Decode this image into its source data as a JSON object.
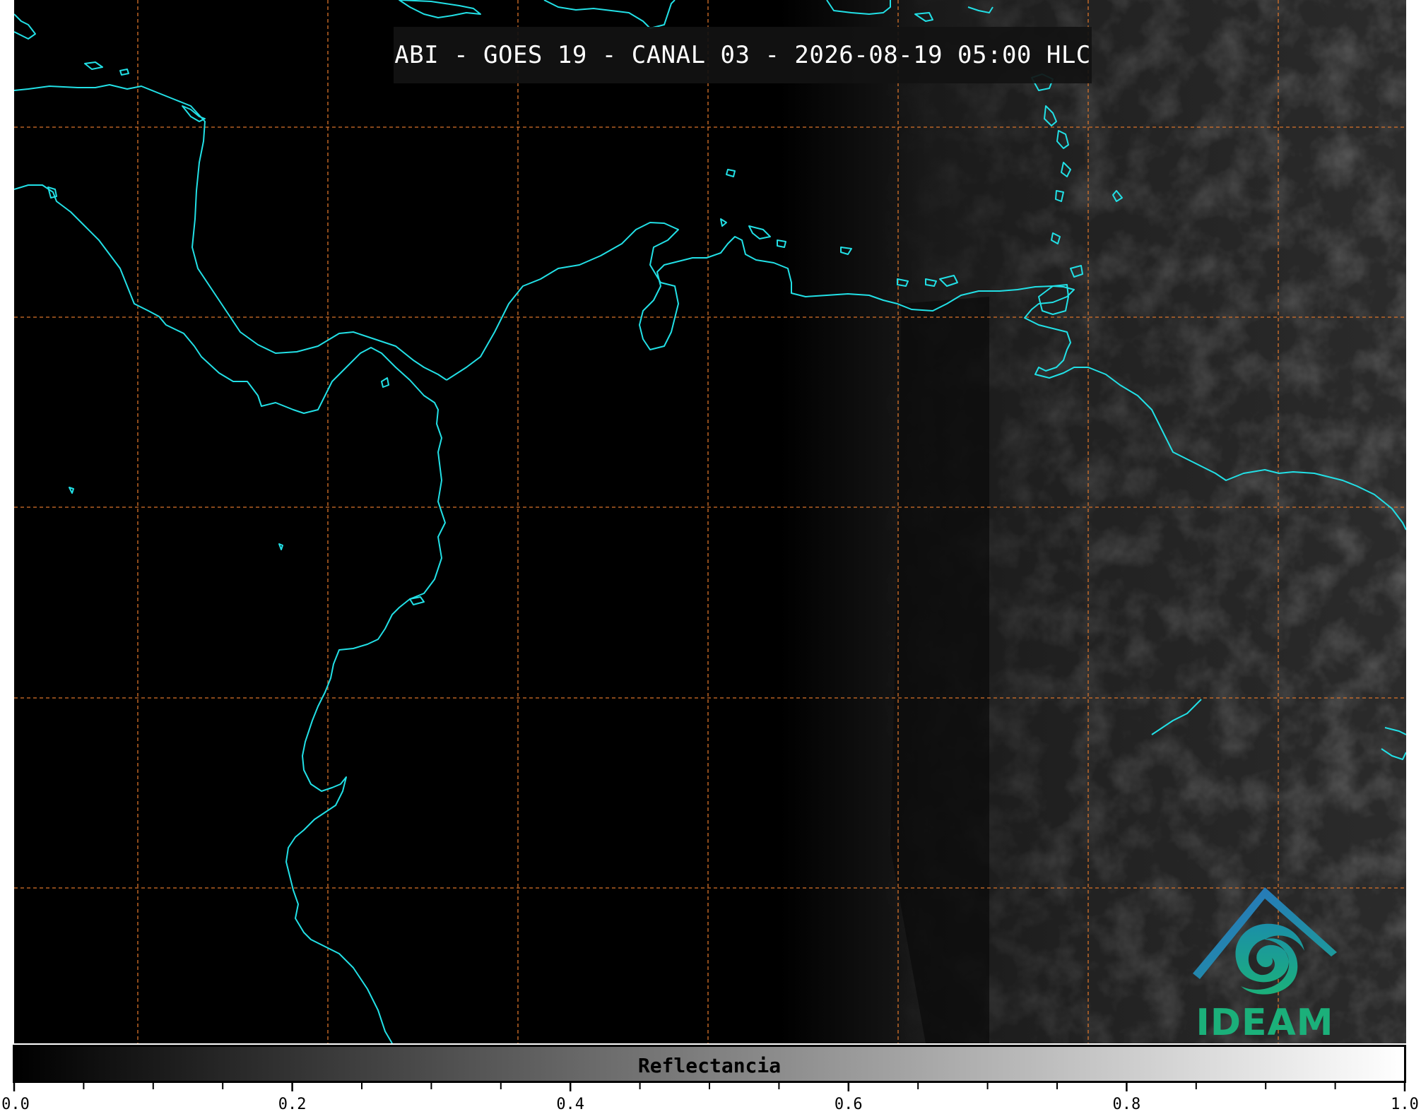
{
  "title": "ABI - GOES 19 - CANAL 03 - 2026-08-19 05:00 HLC",
  "colorbar": {
    "label": "Reflectancia",
    "min": 0.0,
    "max": 1.0,
    "tick_labels": [
      "0.0",
      "0.2",
      "0.4",
      "0.6",
      "0.8",
      "1.0"
    ],
    "minor_tick_step": 0.05,
    "colormap": "grayscale black-to-white"
  },
  "logo": {
    "text": "IDEAM",
    "text_color": "#1bb07a",
    "roof_color": "#2a6fc4"
  },
  "map": {
    "coastline_color": "#22e0e6",
    "grid_color": "#d9732a",
    "grid_style": "dashed",
    "background": "#000000"
  }
}
